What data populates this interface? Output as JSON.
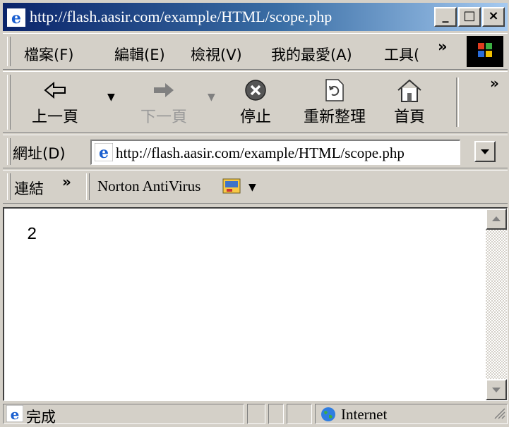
{
  "window": {
    "title": "http://flash.aasir.com/example/HTML/scope.php",
    "min_btn": "_",
    "max_btn": "□",
    "close_btn": "×"
  },
  "menu": {
    "items": [
      "檔案(F)",
      "編輯(E)",
      "檢視(V)",
      "我的最愛(A)",
      "工具(",
      "»"
    ]
  },
  "toolbar": {
    "back": "上一頁",
    "forward": "下一頁",
    "stop": "停止",
    "refresh": "重新整理",
    "home": "首頁",
    "more": "»"
  },
  "address": {
    "label": "網址(D)",
    "value": "http://flash.aasir.com/example/HTML/scope.php"
  },
  "links": {
    "label": "連結",
    "more": "»",
    "item": "Norton AntiVirus"
  },
  "page": {
    "content": "2"
  },
  "status": {
    "text": "完成",
    "zone": "Internet"
  },
  "colors": {
    "title_start": "#0a246a",
    "title_end": "#a6caf0",
    "chrome": "#d4d0c8"
  }
}
